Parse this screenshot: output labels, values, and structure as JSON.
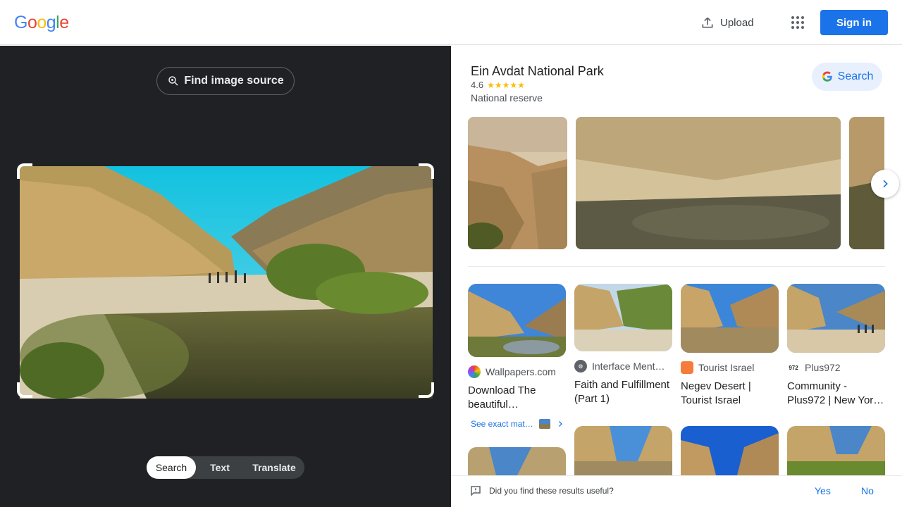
{
  "header": {
    "logo_letters": [
      "G",
      "o",
      "o",
      "g",
      "l",
      "e"
    ],
    "upload_label": "Upload",
    "signin_label": "Sign in"
  },
  "left": {
    "find_source_label": "Find image source",
    "tabs": [
      {
        "label": "Search",
        "active": true
      },
      {
        "label": "Text",
        "active": false
      },
      {
        "label": "Translate",
        "active": false
      }
    ]
  },
  "knowledge": {
    "title": "Ein Avdat National Park",
    "rating": "4.6",
    "stars": "★★★★★",
    "subtitle": "National reserve",
    "search_label": "Search"
  },
  "results": [
    {
      "source": "Wallpapers.com",
      "title": "Download The beautiful…"
    },
    {
      "source": "Interface Ment…",
      "title": "Faith and Fulfillment (Part 1)"
    },
    {
      "source": "Tourist Israel",
      "title": "Negev Desert | Tourist Israel"
    },
    {
      "source": "Plus972",
      "title": "Community - Plus972 | New Yor…"
    }
  ],
  "exact_match_label": "See exact mat…",
  "feedback": {
    "question": "Did you find these results useful?",
    "yes": "Yes",
    "no": "No"
  },
  "colors": {
    "google_blue": "#4285f4",
    "google_red": "#ea4335",
    "google_yellow": "#fbbc05",
    "google_green": "#34a853",
    "accent": "#1a73e8"
  }
}
